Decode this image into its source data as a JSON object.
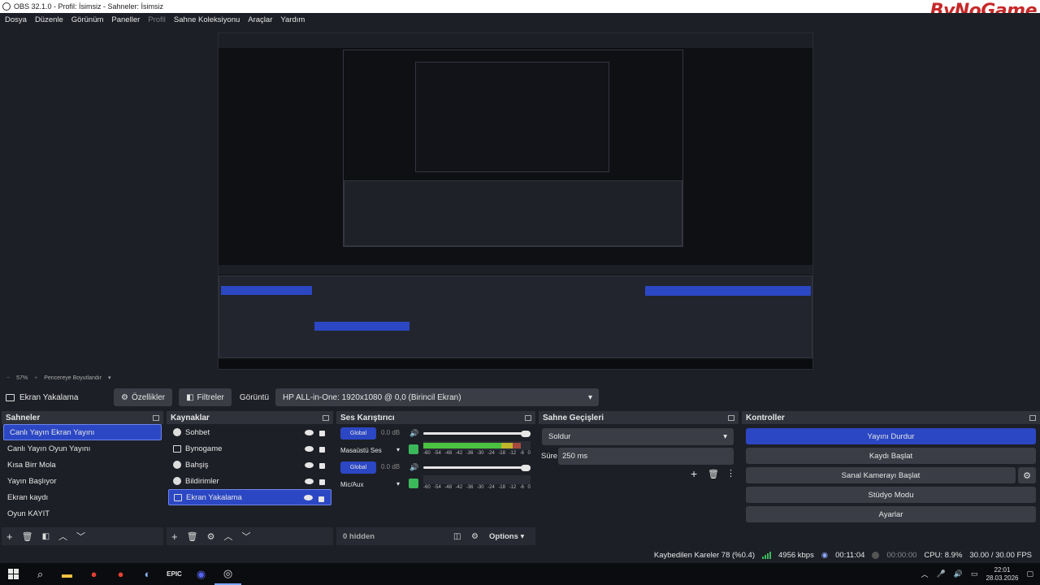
{
  "window": {
    "title": "OBS 32.1.0 - Profil: İsimsiz - Sahneler: İsimsiz",
    "brand": "ByNoGame"
  },
  "menu": [
    "Dosya",
    "Düzenle",
    "Görünüm",
    "Paneller",
    "Profil",
    "Sahne Koleksiyonu",
    "Araçlar",
    "Yardım"
  ],
  "zoombar": {
    "zoom": "57%",
    "resize_label": "Pencereye Boyutlandır"
  },
  "context": {
    "source_name": "Ekran Yakalama",
    "properties_label": "Özellikler",
    "filters_label": "Filtreler",
    "display_label": "Görüntü",
    "display_value": "HP ALL-in-One: 1920x1080 @ 0,0 (Birincil Ekran)"
  },
  "scenes": {
    "title": "Sahneler",
    "items": [
      "Canlı Yayın Ekran Yayını",
      "Canlı Yayın Oyun Yayını",
      "Kısa Birr Mola",
      "Yayın Başlıyor",
      "Ekran kaydı",
      "Oyun KAYIT"
    ],
    "selected_index": 0
  },
  "sources": {
    "title": "Kaynaklar",
    "items": [
      {
        "label": "Sohbet",
        "icon": "globe-icon"
      },
      {
        "label": "Bynogame",
        "icon": "image-icon"
      },
      {
        "label": "Bahşiş",
        "icon": "globe-icon"
      },
      {
        "label": "Bildirimler",
        "icon": "globe-icon"
      },
      {
        "label": "Ekran Yakalama",
        "icon": "monitor-icon"
      }
    ],
    "selected_index": 4
  },
  "mixer": {
    "title": "Ses Karıştırıcı",
    "channels": [
      {
        "global_label": "Global",
        "db": "0.0 dB",
        "name": "Masaüstü Ses",
        "level": 0.82
      },
      {
        "global_label": "Global",
        "db": "0.0 dB",
        "name": "Mic/Aux",
        "level": 0.0
      }
    ],
    "scale": [
      "-60",
      "-54",
      "-48",
      "-42",
      "-36",
      "-30",
      "-24",
      "-18",
      "-12",
      "-6",
      "0"
    ],
    "hidden_label": "0 hidden",
    "options_label": "Options"
  },
  "transitions": {
    "title": "Sahne Geçişleri",
    "selected": "Soldur",
    "duration_label": "Süre",
    "duration_value": "250 ms"
  },
  "controls": {
    "title": "Kontroller",
    "stop_stream": "Yayını Durdur",
    "start_record": "Kaydı Başlat",
    "start_virtual_cam": "Sanal Kamerayı Başlat",
    "studio_mode": "Stüdyo Modu",
    "settings": "Ayarlar"
  },
  "status": {
    "dropped_frames": "Kaybedilen Kareler 78 (%0.4)",
    "bitrate": "4956 kbps",
    "stream_time": "00:11:04",
    "record_time": "00:00:00",
    "cpu": "CPU: 8.9%",
    "fps": "30.00 / 30.00 FPS"
  },
  "taskbar": {
    "time": "22:01",
    "date": "28.03.2026"
  },
  "colors": {
    "accent": "#2b47c4",
    "panel": "#272a33",
    "background": "#1d1f26",
    "meter_green": "#4bc240",
    "meter_yellow": "#c1b62c",
    "meter_red": "#a64a40",
    "brand_red": "#c62828"
  }
}
